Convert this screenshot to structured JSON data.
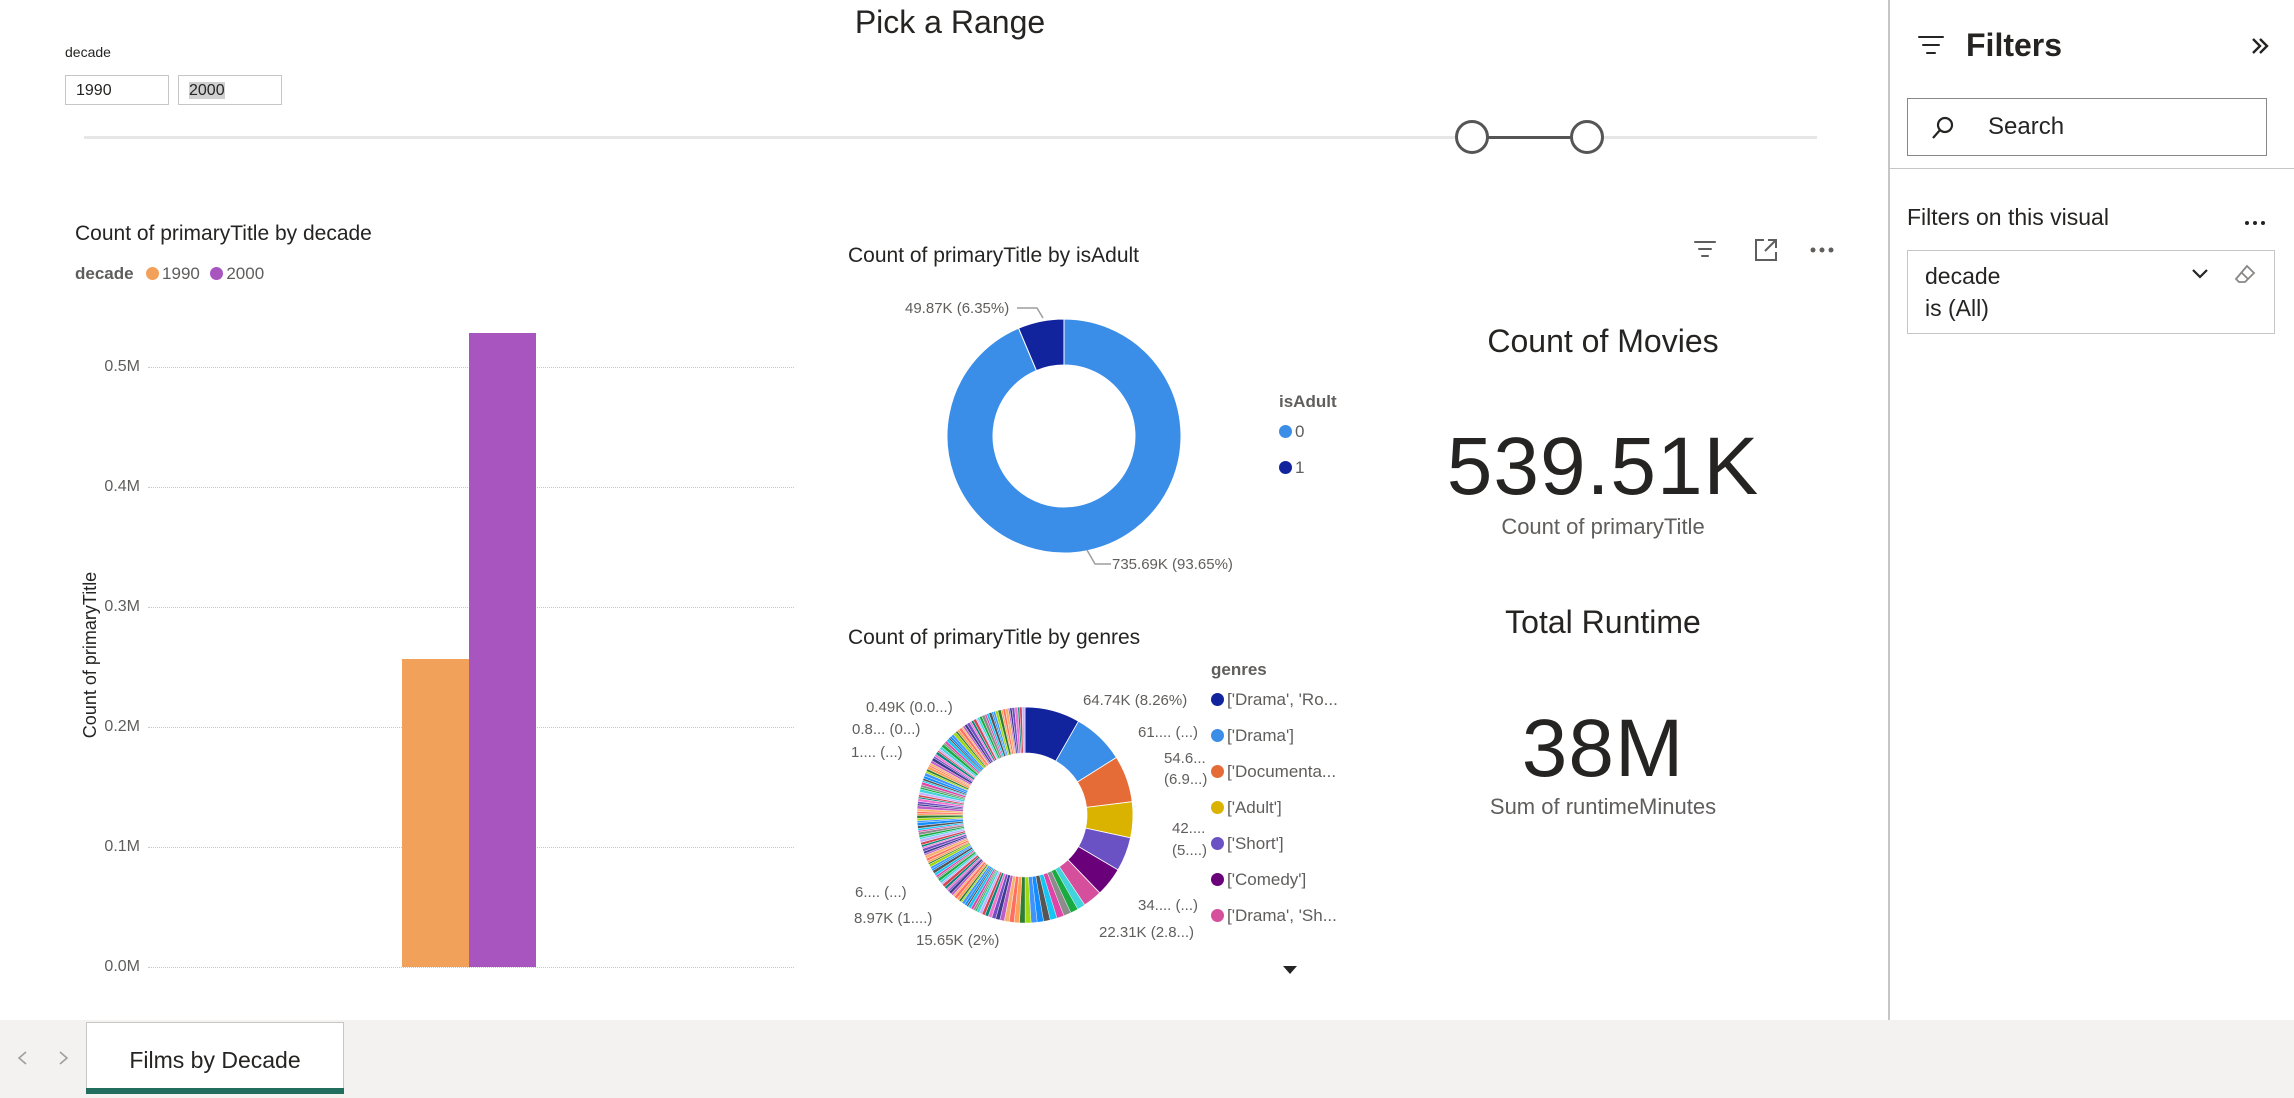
{
  "slicer": {
    "title": "Pick a Range",
    "field_label": "decade",
    "from_value": "1990",
    "to_value": "2000"
  },
  "bar_visual": {
    "title": "Count of primaryTitle by decade",
    "legend_title": "decade",
    "ylabel": "Count of primaryTitle",
    "y_ticks": [
      "0.0M",
      "0.1M",
      "0.2M",
      "0.3M",
      "0.4M",
      "0.5M"
    ]
  },
  "donut_visual": {
    "title": "Count of primaryTitle by isAdult",
    "legend_title": "isAdult",
    "labels": [
      "49.87K (6.35%)",
      "735.69K (93.65%)"
    ]
  },
  "genres_visual": {
    "title": "Count of primaryTitle by genres",
    "legend_title": "genres",
    "legend_items": [
      "['Drama', 'Ro...",
      "['Drama']",
      "['Documenta...",
      "['Adult']",
      "['Short']",
      "['Comedy']",
      "['Drama', 'Sh..."
    ],
    "legend_colors": [
      "#12239e",
      "#3b8ee8",
      "#e66c37",
      "#d9b300",
      "#6b52c4",
      "#6b007b",
      "#d64f9c"
    ],
    "labels": {
      "l1": "0.49K (0.0...)",
      "l2": "0.8... (0...)",
      "l3": "1.... (...)",
      "l4": "64.74K (8.26%)",
      "l5": "61.... (...)",
      "l6a": "54.6...",
      "l6b": "(6.9...)",
      "l7a": "42....",
      "l7b": "(5....)",
      "l8": "34.... (...)",
      "l9": "22.31K (2.8...)",
      "l10": "15.65K (2%)",
      "l11": "8.97K (1....)",
      "l12": "6.... (...)"
    }
  },
  "card_movies": {
    "title": "Count of Movies",
    "value": "539.51K",
    "label": "Count of primaryTitle"
  },
  "card_runtime": {
    "title": "Total Runtime",
    "value": "38M",
    "label": "Sum of runtimeMinutes"
  },
  "filters_pane": {
    "title": "Filters",
    "search_placeholder": "Search",
    "section_title": "Filters on this visual",
    "filter_field": "decade",
    "filter_state": "is (All)"
  },
  "tabs": {
    "active": "Films by Decade"
  },
  "icons": {
    "filter": "filter-icon",
    "focus": "focus-mode-icon",
    "more": "more-options-icon",
    "collapse": "collapse-pane-icon",
    "search": "search-icon",
    "chevron": "chevron-down-icon",
    "eraser": "clear-filter-icon"
  },
  "chart_data": [
    {
      "type": "bar",
      "title": "Count of primaryTitle by decade",
      "ylabel": "Count of primaryTitle",
      "xlabel": "",
      "legend_title": "decade",
      "series": [
        {
          "name": "1990",
          "color": "#f2a15a",
          "values": [
            257000
          ]
        },
        {
          "name": "2000",
          "color": "#a855c0",
          "values": [
            528000
          ]
        }
      ],
      "ylim": [
        0,
        540000
      ],
      "grid": true,
      "legend_position": "top-left"
    },
    {
      "type": "pie",
      "title": "Count of primaryTitle by isAdult",
      "legend_title": "isAdult",
      "slices": [
        {
          "name": "0",
          "value": 735690,
          "color": "#3b8ee8"
        },
        {
          "name": "1",
          "value": 49870,
          "color": "#12239e"
        }
      ]
    },
    {
      "type": "pie",
      "title": "Count of primaryTitle by genres",
      "legend_title": "genres",
      "slices": [
        {
          "name": "['Drama', 'Ro...",
          "value": 64740,
          "color": "#12239e"
        },
        {
          "name": "['Drama']",
          "value": 61000,
          "color": "#3b8ee8"
        },
        {
          "name": "['Documenta...",
          "value": 54600,
          "color": "#e66c37"
        },
        {
          "name": "['Adult']",
          "value": 42000,
          "color": "#d9b300"
        },
        {
          "name": "['Short']",
          "value": 40000,
          "color": "#6b52c4"
        },
        {
          "name": "['Comedy']",
          "value": 34000,
          "color": "#6b007b"
        },
        {
          "name": "['Drama', 'Sh...",
          "value": 22310,
          "color": "#d64f9c"
        }
      ]
    }
  ]
}
